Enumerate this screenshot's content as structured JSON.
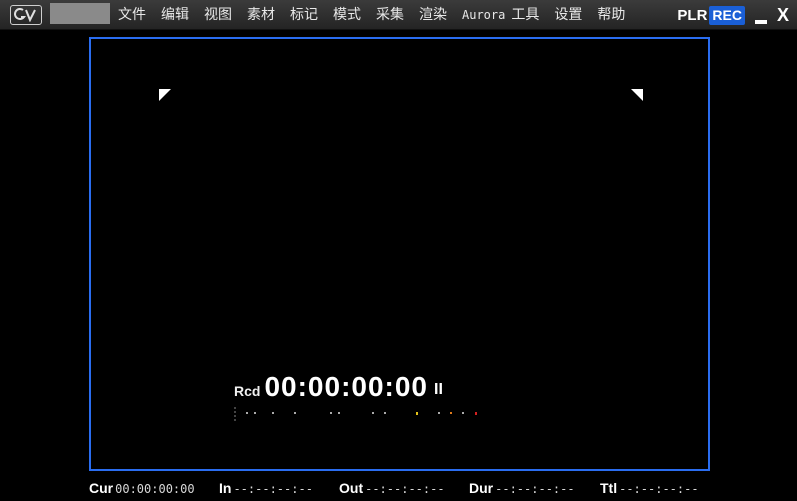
{
  "menubar": {
    "logo_icon": "gv-logo-icon",
    "items": [
      "文件",
      "编辑",
      "视图",
      "素材",
      "标记",
      "模式",
      "采集",
      "渲染",
      "Aurora",
      "工具",
      "设置",
      "帮助"
    ],
    "plr_label": "PLR",
    "rec_label": "REC",
    "rec_color": "#1a5fd6",
    "minimize_icon": "minimize-icon",
    "close_label": "X"
  },
  "viewer": {
    "border_color": "#2a6df0",
    "timecode_label": "Rcd",
    "timecode_value": "00:00:00:00",
    "pause_glyph": "II"
  },
  "status": {
    "cur_label": "Cur",
    "cur_value": "00:00:00:00",
    "in_label": "In",
    "in_value": "--:--:--:--",
    "out_label": "Out",
    "out_value": "--:--:--:--",
    "dur_label": "Dur",
    "dur_value": "--:--:--:--",
    "ttl_label": "Ttl",
    "ttl_value": "--:--:--:--"
  }
}
